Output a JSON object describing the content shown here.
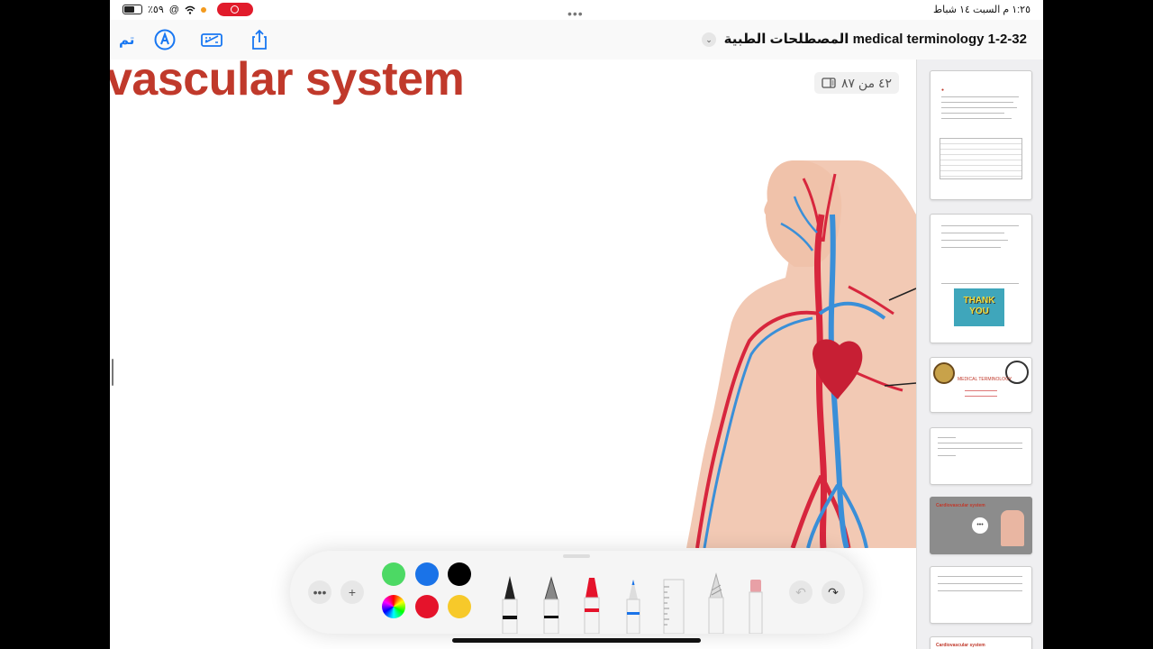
{
  "status_bar": {
    "time_date": "١:٢٥ م   السبت ١٤ شباط",
    "battery": "٪٥٩",
    "center_dots": "•••"
  },
  "nav": {
    "done_label": "تم",
    "document_title": "المصطلحات الطبية  medical terminology 1-2-32",
    "chevron": "⌄"
  },
  "page": {
    "slide_title": "vascular system",
    "page_indicator": "٤٢ من ٨٧"
  },
  "toolbar": {
    "more_label": "•••",
    "add_label": "+",
    "colors": [
      "#4cd964",
      "#1a73e8",
      "#000000",
      "rainbow",
      "#e5132b",
      "#f7c92a"
    ],
    "undo_label": "↶",
    "redo_label": "↷"
  },
  "sidebar": {
    "thank_you": "THANK YOU",
    "medical_terminology": "MEDICAL TERMINOLOGY",
    "cardio_title": "Cardiovascular system",
    "cardio_title_2": "Cardiovascular system"
  },
  "colors": {
    "accent": "#1877f2",
    "slide_title": "#c0392b",
    "record": "#e11b2b"
  }
}
